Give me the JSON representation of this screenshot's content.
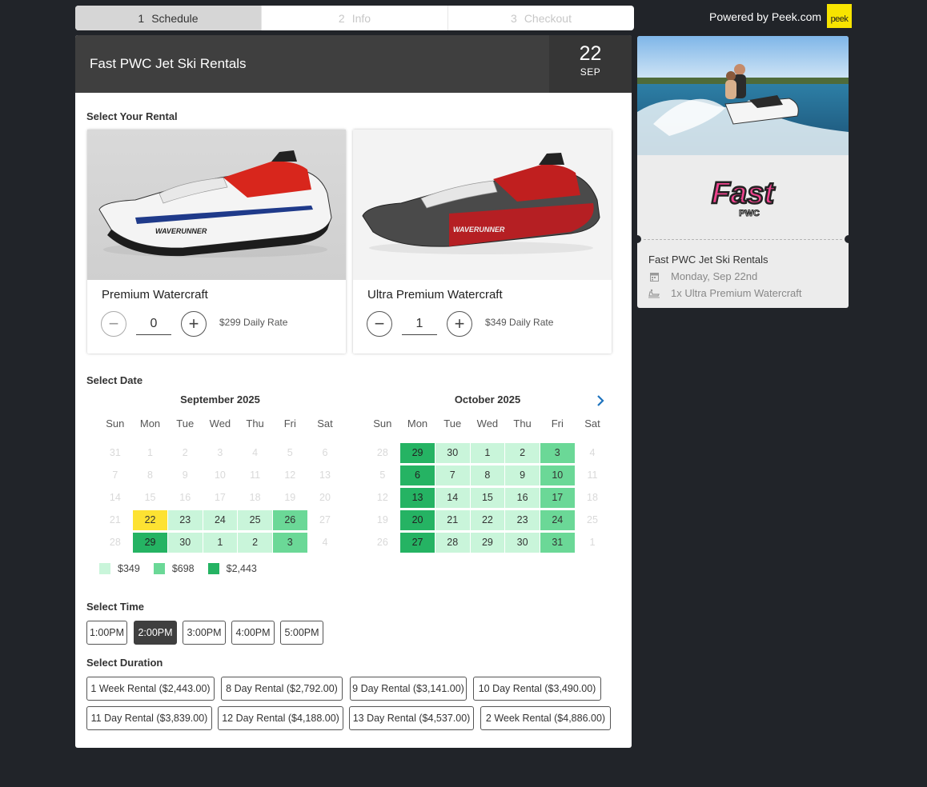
{
  "steps": [
    {
      "num": "1",
      "label": "Schedule"
    },
    {
      "num": "2",
      "label": "Info"
    },
    {
      "num": "3",
      "label": "Checkout"
    }
  ],
  "powered_by": "Powered by Peek.com",
  "peek_logo_text": "peek",
  "header": {
    "title": "Fast PWC Jet Ski Rentals",
    "date_day": "22",
    "date_month": "SEP"
  },
  "sections": {
    "rental": "Select Your Rental",
    "date": "Select Date",
    "time": "Select Time",
    "duration": "Select Duration"
  },
  "rentals": [
    {
      "name": "Premium Watercraft",
      "quantity": "0",
      "rate": "$299 Daily Rate",
      "accent": "#d8261c"
    },
    {
      "name": "Ultra Premium Watercraft",
      "quantity": "1",
      "rate": "$349 Daily Rate",
      "accent": "#c01f1f"
    }
  ],
  "calendar": {
    "weekdays": [
      "Sun",
      "Mon",
      "Tue",
      "Wed",
      "Thu",
      "Fri",
      "Sat"
    ],
    "months": [
      {
        "title": "September 2025",
        "days": [
          {
            "d": "31",
            "s": "faint"
          },
          {
            "d": "1",
            "s": "faint"
          },
          {
            "d": "2",
            "s": "faint"
          },
          {
            "d": "3",
            "s": "faint"
          },
          {
            "d": "4",
            "s": "faint"
          },
          {
            "d": "5",
            "s": "faint"
          },
          {
            "d": "6",
            "s": "faint"
          },
          {
            "d": "7",
            "s": "faint"
          },
          {
            "d": "8",
            "s": "faint"
          },
          {
            "d": "9",
            "s": "faint"
          },
          {
            "d": "10",
            "s": "faint"
          },
          {
            "d": "11",
            "s": "faint"
          },
          {
            "d": "12",
            "s": "faint"
          },
          {
            "d": "13",
            "s": "faint"
          },
          {
            "d": "14",
            "s": "faint"
          },
          {
            "d": "15",
            "s": "faint"
          },
          {
            "d": "16",
            "s": "faint"
          },
          {
            "d": "17",
            "s": "faint"
          },
          {
            "d": "18",
            "s": "faint"
          },
          {
            "d": "19",
            "s": "faint"
          },
          {
            "d": "20",
            "s": "faint"
          },
          {
            "d": "21",
            "s": "faint"
          },
          {
            "d": "22",
            "s": "sel"
          },
          {
            "d": "23",
            "s": "l1"
          },
          {
            "d": "24",
            "s": "l1"
          },
          {
            "d": "25",
            "s": "l1"
          },
          {
            "d": "26",
            "s": "l2"
          },
          {
            "d": "27",
            "s": "faint"
          },
          {
            "d": "28",
            "s": "faint"
          },
          {
            "d": "29",
            "s": "l3"
          },
          {
            "d": "30",
            "s": "l1"
          },
          {
            "d": "1",
            "s": "l1"
          },
          {
            "d": "2",
            "s": "l1"
          },
          {
            "d": "3",
            "s": "l2"
          },
          {
            "d": "4",
            "s": "faint"
          }
        ]
      },
      {
        "title": "October 2025",
        "days": [
          {
            "d": "28",
            "s": "faint"
          },
          {
            "d": "29",
            "s": "l3"
          },
          {
            "d": "30",
            "s": "l1"
          },
          {
            "d": "1",
            "s": "l1"
          },
          {
            "d": "2",
            "s": "l1"
          },
          {
            "d": "3",
            "s": "l2"
          },
          {
            "d": "4",
            "s": "faint"
          },
          {
            "d": "5",
            "s": "faint"
          },
          {
            "d": "6",
            "s": "l3"
          },
          {
            "d": "7",
            "s": "l1"
          },
          {
            "d": "8",
            "s": "l1"
          },
          {
            "d": "9",
            "s": "l1"
          },
          {
            "d": "10",
            "s": "l2"
          },
          {
            "d": "11",
            "s": "faint"
          },
          {
            "d": "12",
            "s": "faint"
          },
          {
            "d": "13",
            "s": "l3"
          },
          {
            "d": "14",
            "s": "l1"
          },
          {
            "d": "15",
            "s": "l1"
          },
          {
            "d": "16",
            "s": "l1"
          },
          {
            "d": "17",
            "s": "l2"
          },
          {
            "d": "18",
            "s": "faint"
          },
          {
            "d": "19",
            "s": "faint"
          },
          {
            "d": "20",
            "s": "l3"
          },
          {
            "d": "21",
            "s": "l1"
          },
          {
            "d": "22",
            "s": "l1"
          },
          {
            "d": "23",
            "s": "l1"
          },
          {
            "d": "24",
            "s": "l2"
          },
          {
            "d": "25",
            "s": "faint"
          },
          {
            "d": "26",
            "s": "faint"
          },
          {
            "d": "27",
            "s": "l3"
          },
          {
            "d": "28",
            "s": "l1"
          },
          {
            "d": "29",
            "s": "l1"
          },
          {
            "d": "30",
            "s": "l1"
          },
          {
            "d": "31",
            "s": "l2"
          },
          {
            "d": "1",
            "s": "faint"
          }
        ]
      }
    ],
    "next_icon": "chevron-right-icon"
  },
  "legend": [
    {
      "price": "$349",
      "color": "#c9f5da"
    },
    {
      "price": "$698",
      "color": "#6bd897"
    },
    {
      "price": "$2,443",
      "color": "#25b363"
    }
  ],
  "times": [
    "1:00PM",
    "2:00PM",
    "3:00PM",
    "4:00PM",
    "5:00PM"
  ],
  "selected_time": "2:00PM",
  "durations": [
    "1 Week Rental ($2,443.00)",
    "8 Day Rental ($2,792.00)",
    "9 Day Rental ($3,141.00)",
    "10 Day Rental ($3,490.00)",
    "11 Day Rental ($3,839.00)",
    "12 Day Rental ($4,188.00)",
    "13 Day Rental ($4,537.00)",
    "2 Week Rental ($4,886.00)"
  ],
  "summary": {
    "logo_text": "Fast",
    "logo_sub": "PWC",
    "title": "Fast PWC Jet Ski Rentals",
    "date": "Monday, Sep 22nd",
    "item": "1x Ultra Premium Watercraft"
  },
  "colors": {
    "selected_day": "#fde232",
    "logo_pink": "#f0438e",
    "link_blue": "#1e73be"
  }
}
